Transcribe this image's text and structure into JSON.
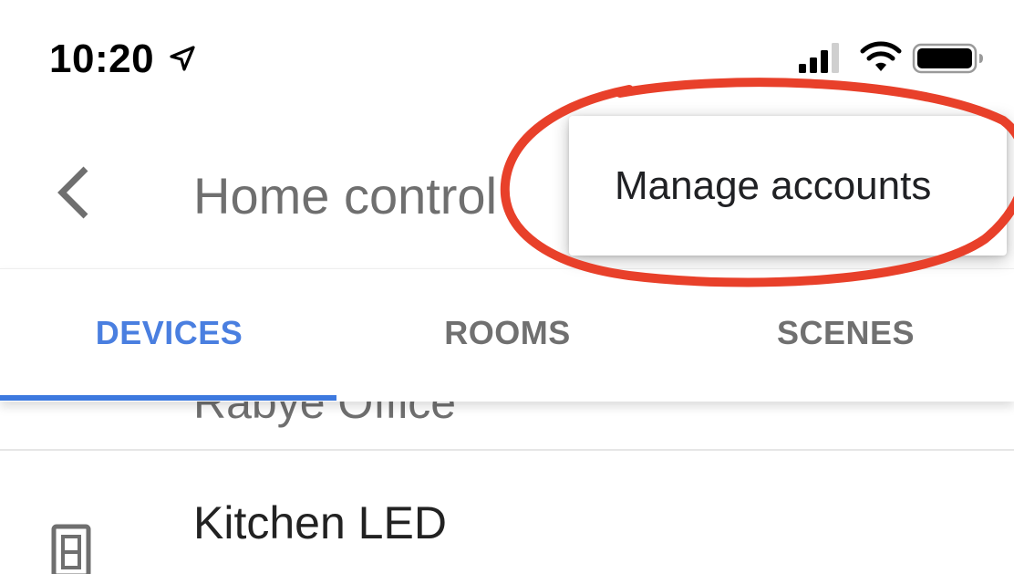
{
  "status_bar": {
    "time": "10:20",
    "icons": [
      "location-arrow-icon",
      "cellular-signal-icon",
      "wifi-icon",
      "battery-icon"
    ]
  },
  "header": {
    "back_icon": "chevron-left-icon",
    "title": "Home control"
  },
  "tabs": [
    {
      "label": "DEVICES",
      "active": true
    },
    {
      "label": "ROOMS",
      "active": false
    },
    {
      "label": "SCENES",
      "active": false
    }
  ],
  "list": {
    "partial_item_label": "Rabye Office",
    "items": [
      {
        "name": "Kitchen LED",
        "icon": "light-switch-icon"
      }
    ]
  },
  "menu": {
    "items": [
      {
        "label": "Manage accounts"
      }
    ]
  },
  "colors": {
    "accent": "#4a7fe0",
    "indicator": "#3d79df",
    "annotation": "#e8402a",
    "muted_text": "#707070"
  }
}
